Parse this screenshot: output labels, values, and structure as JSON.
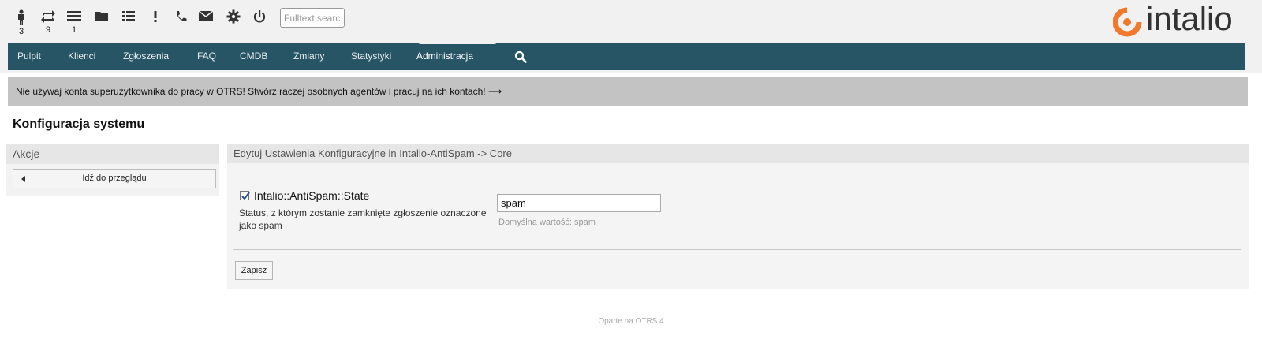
{
  "toolbar": {
    "icons": [
      {
        "name": "person-icon",
        "count": "3"
      },
      {
        "name": "escalation-icon",
        "count": "9"
      },
      {
        "name": "queue-view-icon",
        "count": "1"
      },
      {
        "name": "folder-icon",
        "count": ""
      },
      {
        "name": "list-icon",
        "count": ""
      },
      {
        "name": "exclamation-icon",
        "count": ""
      },
      {
        "name": "phone-icon",
        "count": ""
      },
      {
        "name": "envelope-icon",
        "count": ""
      },
      {
        "name": "gear-icon",
        "count": ""
      },
      {
        "name": "power-icon",
        "count": ""
      }
    ],
    "search_placeholder": "Fulltext search"
  },
  "logo": {
    "text": "intalio",
    "accent_color": "#f0792b"
  },
  "nav": {
    "items": [
      "Pulpit",
      "Klienci",
      "Zgłoszenia",
      "FAQ",
      "CMDB",
      "Zmiany",
      "Statystyki",
      "Administracja"
    ],
    "active": "Administracja",
    "search_icon": "search-icon",
    "bg_color": "#275566"
  },
  "notice": {
    "text": "Nie używaj konta superużytkownika do pracy w OTRS! Stwórz raczej osobnych agentów i pracuj na ich kontach! ⟶"
  },
  "page": {
    "title": "Konfiguracja systemu"
  },
  "sidebar": {
    "header": "Akcje",
    "overview_button": "Idź do przeglądu"
  },
  "main": {
    "header": "Edytuj Ustawienia Konfiguracyjne in Intalio-AntiSpam -> Core",
    "setting": {
      "checked": true,
      "name": "Intalio::AntiSpam::State",
      "description": "Status, z którym zostanie zamknięte zgłoszenie oznaczone jako spam",
      "value": "spam",
      "default_label": "Domyślna wartość: spam"
    },
    "save_button": "Zapisz"
  },
  "footer": {
    "text": "Oparte na OTRS 4"
  }
}
